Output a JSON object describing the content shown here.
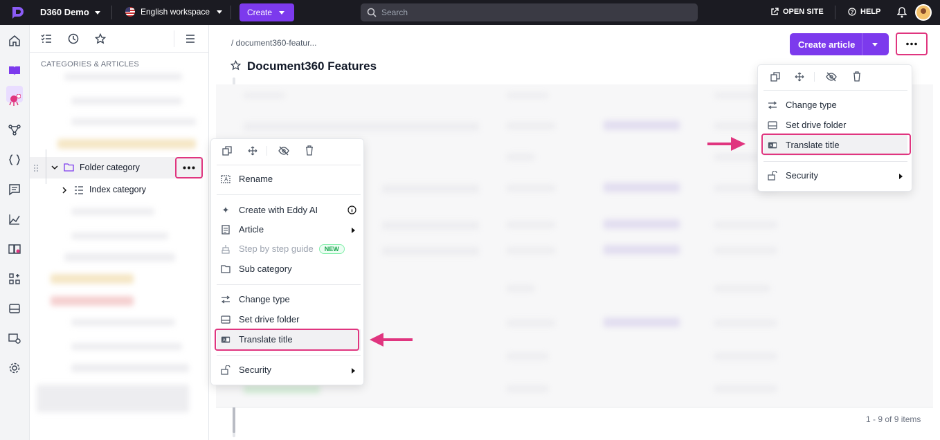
{
  "topbar": {
    "project_name": "D360 Demo",
    "workspace": "English workspace",
    "create_label": "Create",
    "search_placeholder": "Search",
    "open_site": "OPEN SITE",
    "help": "HELP"
  },
  "tree": {
    "section_heading": "CATEGORIES & ARTICLES",
    "folder_category": "Folder category",
    "index_category": "Index category"
  },
  "main": {
    "breadcrumb": "/ document360-featur...",
    "title": "Document360 Features",
    "create_article": "Create article",
    "pagination": "1 - 9 of 9 items"
  },
  "context_menu": {
    "rename": "Rename",
    "create_with_eddy": "Create with Eddy AI",
    "article": "Article",
    "step_by_step": "Step by step guide",
    "new_badge": "NEW",
    "sub_category": "Sub category",
    "change_type": "Change type",
    "set_drive_folder": "Set drive folder",
    "translate_title": "Translate title",
    "security": "Security"
  },
  "top_menu": {
    "change_type": "Change type",
    "set_drive_folder": "Set drive folder",
    "translate_title": "Translate title",
    "security": "Security"
  },
  "colors": {
    "accent": "#7c3aed",
    "highlight": "#e0357f",
    "topbar": "#1b1b22"
  }
}
